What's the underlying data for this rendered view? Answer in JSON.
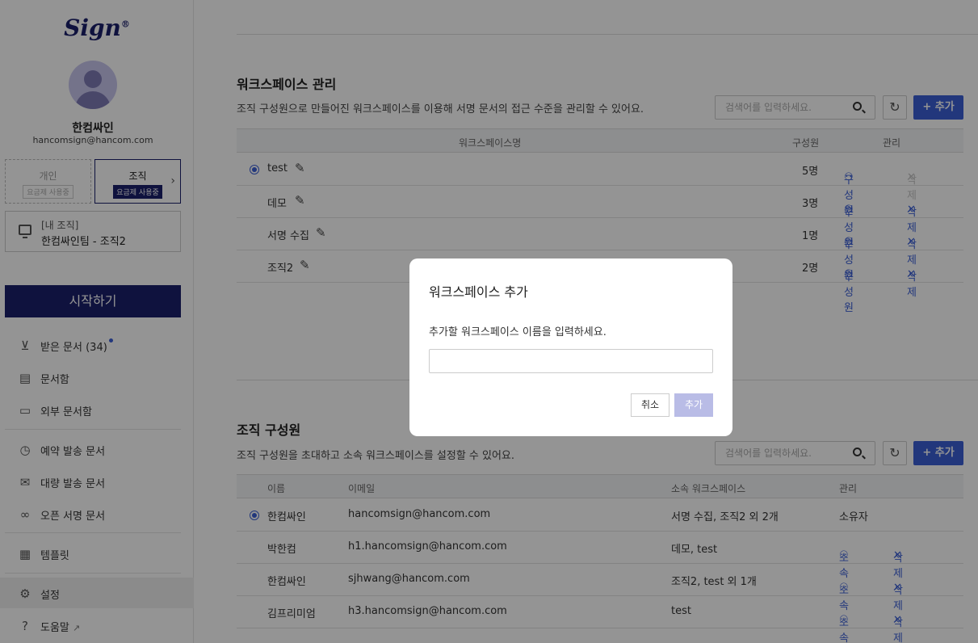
{
  "sidebar": {
    "logo": "Sign",
    "logo_mark": "®",
    "user": {
      "name": "한컴싸인",
      "email": "hancomsign@hancom.com"
    },
    "plans": {
      "personal": {
        "label": "개인",
        "badge": "요금제 사용중"
      },
      "org": {
        "label": "조직",
        "badge": "요금제 사용중"
      }
    },
    "org_box": {
      "line1": "[내 조직]",
      "line2": "한컴싸인팀 - 조직2"
    },
    "start_button": "시작하기",
    "nav": [
      {
        "icon": "inbox-icon",
        "label": "받은 문서 (34)"
      },
      {
        "icon": "document-box-icon",
        "label": "문서함"
      },
      {
        "icon": "external-box-icon",
        "label": "외부 문서함"
      },
      {
        "icon": "scheduled-icon",
        "label": "예약 발송 문서"
      },
      {
        "icon": "bulk-mail-icon",
        "label": "대량 발송 문서"
      },
      {
        "icon": "link-icon",
        "label": "오픈 서명 문서"
      },
      {
        "icon": "template-icon",
        "label": "템플릿"
      },
      {
        "icon": "gear-icon",
        "label": "설정"
      },
      {
        "icon": "help-icon",
        "label": "도움말"
      }
    ]
  },
  "workspace": {
    "title": "워크스페이스 관리",
    "desc": "조직 구성원으로 만들어진 워크스페이스를 이용해 서명 문서의 접근 수준을 관리할 수 있어요.",
    "search_placeholder": "검색어를 입력하세요.",
    "add_label": "+ 추가",
    "headers": {
      "name": "워크스페이스명",
      "members": "구성원",
      "manage": "관리"
    },
    "rows": [
      {
        "name": "test",
        "members": "5명",
        "member_action": "구성원",
        "delete_action": "삭제"
      },
      {
        "name": "데모",
        "members": "3명",
        "member_action": "구성원",
        "delete_action": "삭제"
      },
      {
        "name": "서명 수집",
        "members": "1명",
        "member_action": "구성원",
        "delete_action": "삭제"
      },
      {
        "name": "조직2",
        "members": "2명",
        "member_action": "구성원",
        "delete_action": "삭제"
      }
    ]
  },
  "members": {
    "title": "조직 구성원",
    "desc": "조직 구성원을 초대하고 소속 워크스페이스를 설정할 수 있어요.",
    "search_placeholder": "검색어를 입력하세요.",
    "add_label": "+ 추가",
    "headers": {
      "name": "이름",
      "email": "이메일",
      "workspaces": "소속 워크스페이스",
      "manage": "관리"
    },
    "rows": [
      {
        "name": "한컴싸인",
        "email": "hancomsign@hancom.com",
        "workspaces": "서명 수집, 조직2 외 2개",
        "role": "소유자"
      },
      {
        "name": "박한컴",
        "email": "h1.hancomsign@hancom.com",
        "workspaces": "데모, test",
        "assign_action": "소속",
        "delete_action": "삭제"
      },
      {
        "name": "한컴싸인",
        "email": "sjhwang@hancom.com",
        "workspaces": "조직2, test 외 1개",
        "assign_action": "소속",
        "delete_action": "삭제"
      },
      {
        "name": "김프리미엄",
        "email": "h3.hancomsign@hancom.com",
        "workspaces": "test",
        "assign_action": "소속",
        "delete_action": "삭제"
      }
    ]
  },
  "modal": {
    "title": "워크스페이스 추가",
    "message": "추가할 워크스페이스 이름을 입력하세요.",
    "input_value": "",
    "cancel": "취소",
    "confirm": "추가"
  },
  "colors": {
    "brand": "#1b1f6b",
    "accent": "#3b5fd6",
    "disabled": "#b9bce6"
  }
}
